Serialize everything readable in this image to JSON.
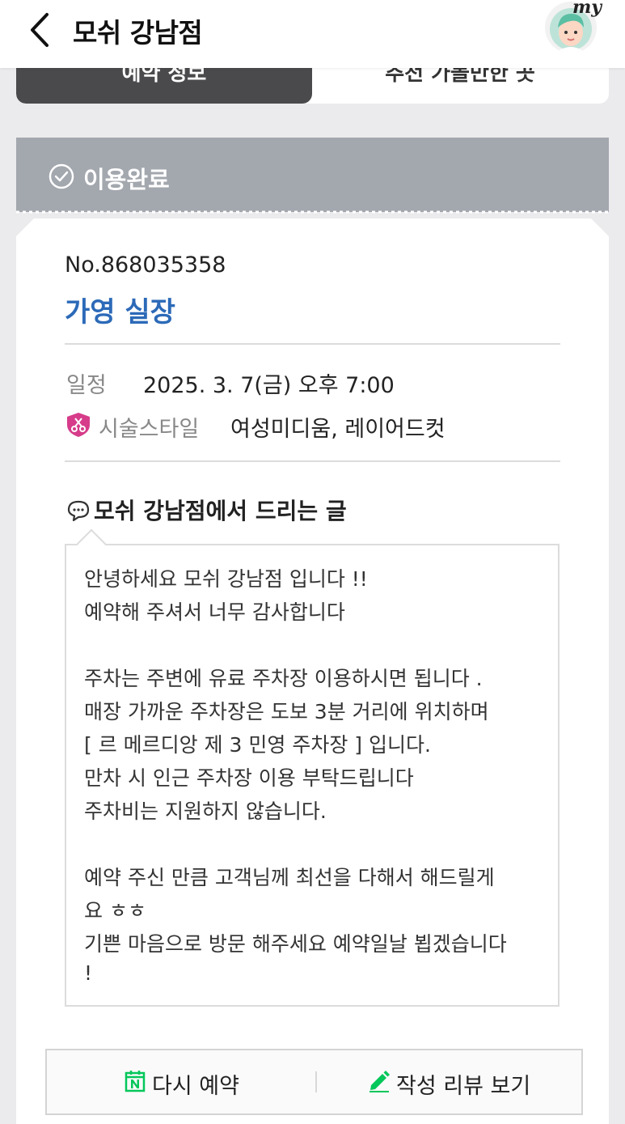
{
  "header": {
    "title": "모쉬 강남점",
    "my_label": "my"
  },
  "tabs": [
    {
      "label": "예약 정보",
      "active": true
    },
    {
      "label": "추천 가볼만한 곳",
      "active": false
    }
  ],
  "status": {
    "label": "이용완료",
    "color": "#a3a7ae"
  },
  "reservation": {
    "number": "No.868035358",
    "designer": "가영 실장",
    "schedule_label": "일정",
    "schedule_value": "2025. 3. 7(금) 오후 7:00",
    "style_label": "시술스타일",
    "style_value": "여성미디움, 레이어드컷"
  },
  "message": {
    "heading": "모쉬 강남점에서 드리는 글",
    "lines": [
      "안녕하세요 모쉬 강남점 입니다 !!",
      "예약해 주셔서 너무 감사합니다",
      "",
      "주차는 주변에 유료 주차장 이용하시면 됩니다 .",
      "매장 가까운 주차장은 도보 3분 거리에 위치하며",
      "[ 르 메르디앙 제 3 민영 주차장 ] 입니다.",
      "만차 시 인근 주차장 이용 부탁드립니다",
      "주차비는 지원하지 않습니다.",
      "",
      "예약 주신 만큼 고객님께 최선을 다해서 해드릴게",
      "요 ㅎㅎ",
      "기쁜 마음으로 방문 해주세요 예약일날 뵙겠습니다",
      "!"
    ]
  },
  "actions": {
    "rebook_label": "다시 예약",
    "review_label": "작성 리뷰 보기"
  },
  "colors": {
    "accent_blue": "#2c6ab8",
    "naver_green": "#03c75a",
    "shield_pink": "#d63c8a"
  }
}
